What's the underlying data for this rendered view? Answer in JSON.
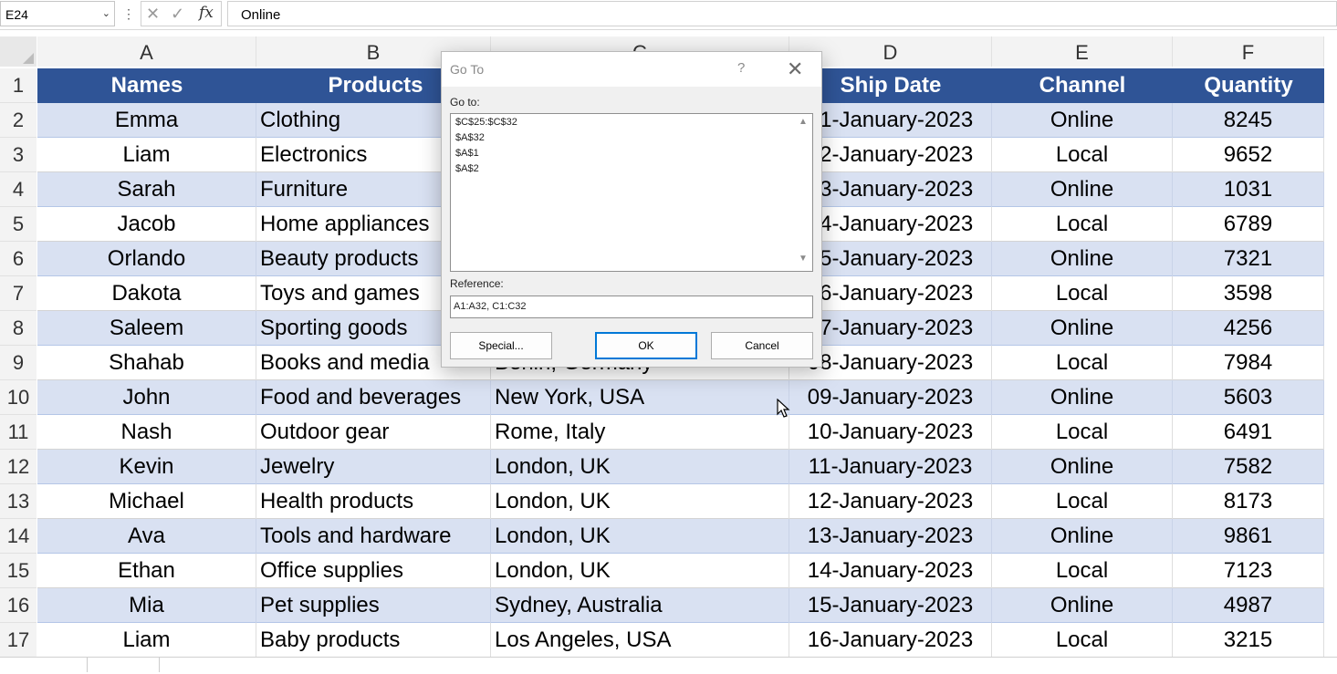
{
  "formula_bar": {
    "name_box": "E24",
    "formula": "Online"
  },
  "columns": [
    "A",
    "B",
    "C",
    "D",
    "E",
    "F"
  ],
  "row_numbers": [
    "1",
    "2",
    "3",
    "4",
    "5",
    "6",
    "7",
    "8",
    "9",
    "10",
    "11",
    "12",
    "13",
    "14",
    "15",
    "16",
    "17"
  ],
  "header": {
    "names": "Names",
    "products": "Products",
    "city": "",
    "ship_date": "Ship Date",
    "channel": "Channel",
    "quantity": "Quantity"
  },
  "rows": [
    {
      "name": "Emma",
      "product": "Clothing",
      "city": "",
      "date": "01-January-2023",
      "channel": "Online",
      "qty": "8245"
    },
    {
      "name": "Liam",
      "product": "Electronics",
      "city": "",
      "date": "02-January-2023",
      "channel": "Local",
      "qty": "9652"
    },
    {
      "name": "Sarah",
      "product": "Furniture",
      "city": "",
      "date": "03-January-2023",
      "channel": "Online",
      "qty": "1031"
    },
    {
      "name": "Jacob",
      "product": "Home appliances",
      "city": "",
      "date": "04-January-2023",
      "channel": "Local",
      "qty": "6789"
    },
    {
      "name": "Orlando",
      "product": "Beauty products",
      "city": "",
      "date": "05-January-2023",
      "channel": "Online",
      "qty": "7321"
    },
    {
      "name": "Dakota",
      "product": "Toys and games",
      "city": "",
      "date": "06-January-2023",
      "channel": "Local",
      "qty": "3598"
    },
    {
      "name": "Saleem",
      "product": "Sporting goods",
      "city": "",
      "date": "07-January-2023",
      "channel": "Online",
      "qty": "4256"
    },
    {
      "name": "Shahab",
      "product": "Books and media",
      "city": "Berlin, Germany",
      "date": "08-January-2023",
      "channel": "Local",
      "qty": "7984"
    },
    {
      "name": "John",
      "product": "Food and beverages",
      "city": "New York, USA",
      "date": "09-January-2023",
      "channel": "Online",
      "qty": "5603"
    },
    {
      "name": "Nash",
      "product": "Outdoor gear",
      "city": "Rome, Italy",
      "date": "10-January-2023",
      "channel": "Local",
      "qty": "6491"
    },
    {
      "name": "Kevin",
      "product": "Jewelry",
      "city": "London, UK",
      "date": "11-January-2023",
      "channel": "Online",
      "qty": "7582"
    },
    {
      "name": "Michael",
      "product": "Health products",
      "city": "London, UK",
      "date": "12-January-2023",
      "channel": "Local",
      "qty": "8173"
    },
    {
      "name": "Ava",
      "product": "Tools and hardware",
      "city": "London, UK",
      "date": "13-January-2023",
      "channel": "Online",
      "qty": "9861"
    },
    {
      "name": "Ethan",
      "product": "Office supplies",
      "city": "London, UK",
      "date": "14-January-2023",
      "channel": "Local",
      "qty": "7123"
    },
    {
      "name": "Mia",
      "product": "Pet supplies",
      "city": "Sydney, Australia",
      "date": "15-January-2023",
      "channel": "Online",
      "qty": "4987"
    },
    {
      "name": "Liam",
      "product": "Baby products",
      "city": "Los Angeles, USA",
      "date": "16-January-2023",
      "channel": "Local",
      "qty": "3215"
    }
  ],
  "dialog": {
    "title": "Go To",
    "help": "?",
    "close": "✕",
    "goto_label": "Go to:",
    "goto_items": [
      "$C$25:$C$32",
      "$A$32",
      "$A$1",
      "$A$2"
    ],
    "reference_label": "Reference:",
    "reference_value": "A1:A32, C1:C32",
    "special_button": "Special...",
    "ok_button": "OK",
    "cancel_button": "Cancel"
  },
  "colors": {
    "header_fill": "#2f5496",
    "band_fill": "#d9e1f2",
    "header_text": "#ffffff"
  },
  "icons": {
    "name_box_dropdown": "chevron-down-icon",
    "cancel_entry": "x-icon",
    "enter_entry": "check-icon",
    "insert_function": "fx-icon"
  }
}
